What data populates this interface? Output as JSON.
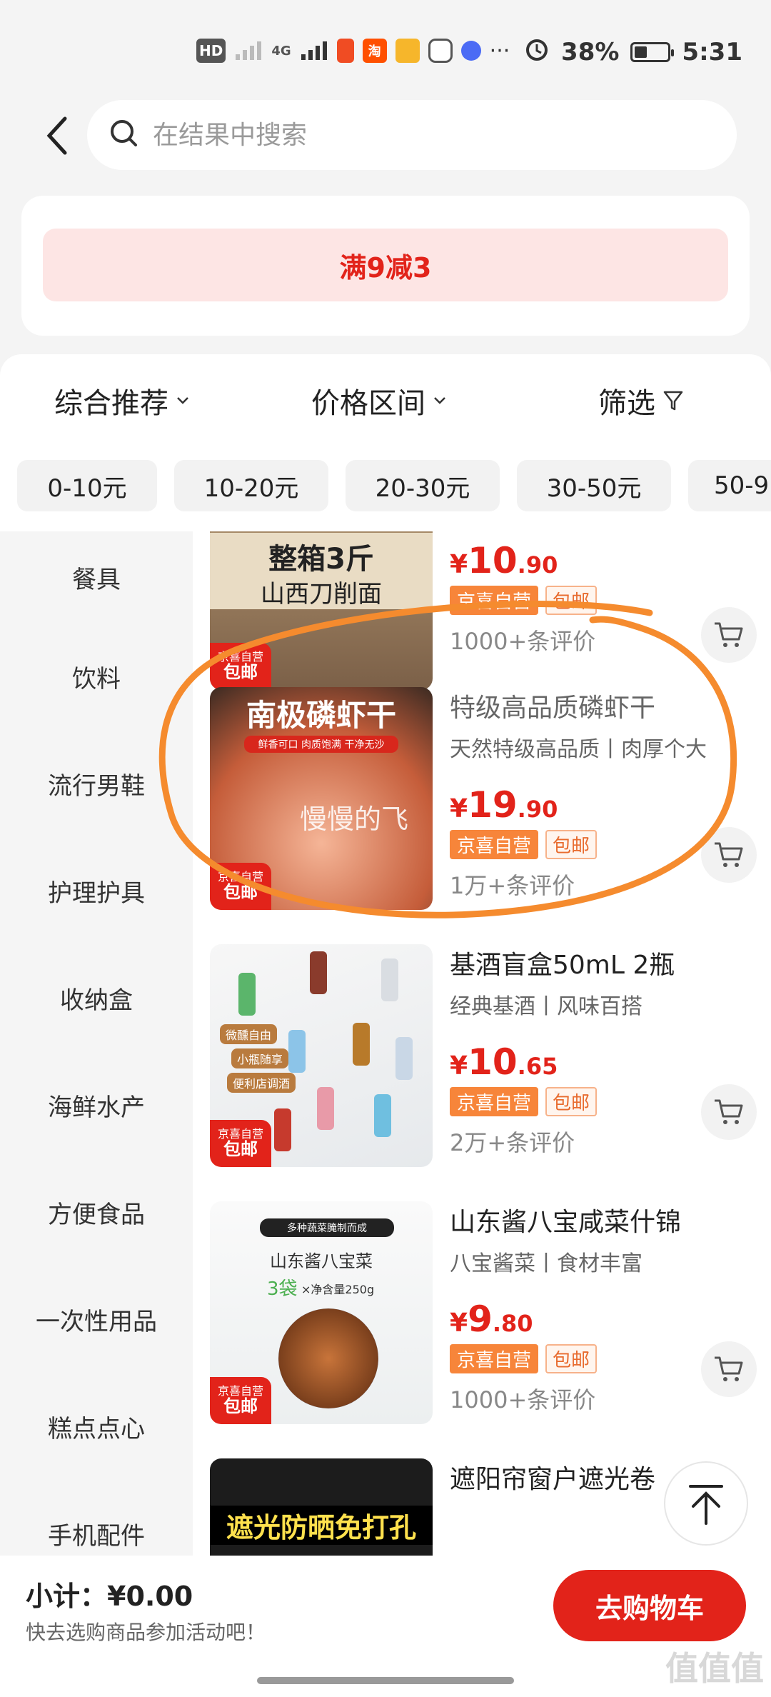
{
  "status_bar": {
    "hd": "HD",
    "net": "4G",
    "battery": "38%",
    "battery_level": 0.38,
    "time": "5:31",
    "dots": "···"
  },
  "search": {
    "placeholder": "在结果中搜索"
  },
  "promo": {
    "label": "满9减3"
  },
  "filters": {
    "tabs": [
      {
        "label": "综合推荐"
      },
      {
        "label": "价格区间"
      },
      {
        "label": "筛选"
      }
    ],
    "price_chips": [
      "0-10元",
      "10-20元",
      "20-30元",
      "30-50元",
      "50-9"
    ]
  },
  "sidebar": {
    "items": [
      "餐具",
      "饮料",
      "流行男鞋",
      "护理护具",
      "收纳盒",
      "海鲜水产",
      "方便食品",
      "一次性用品",
      "糕点点心",
      "手机配件"
    ]
  },
  "products": [
    {
      "image_text": "整箱3斤",
      "image_text2": "山西刀削面",
      "title": "",
      "subtitle": "",
      "price_yen": "¥",
      "price_int": "10",
      "price_dec": ".90",
      "tag_self": "京喜自营",
      "tag_ship": "包邮",
      "reviews": "1000+条评价",
      "badge1": "京喜自营",
      "badge2": "包邮"
    },
    {
      "image_text": "南极磷虾干",
      "image_text2": "鲜香可口 肉质饱满 干净无沙",
      "title": "特级高品质磷虾干",
      "subtitle": "天然特级高品质丨肉厚个大",
      "price_yen": "¥",
      "price_int": "19",
      "price_dec": ".90",
      "tag_self": "京喜自营",
      "tag_ship": "包邮",
      "reviews": "1万+条评价",
      "badge1": "京喜自营",
      "badge2": "包邮"
    },
    {
      "image_text": "微醺自由",
      "image_text2": "小瓶随享",
      "image_text3": "便利店调酒",
      "title": "基酒盲盒50mL  2瓶",
      "subtitle": "经典基酒丨风味百搭",
      "price_yen": "¥",
      "price_int": "10",
      "price_dec": ".65",
      "tag_self": "京喜自营",
      "tag_ship": "包邮",
      "reviews": "2万+条评价",
      "badge1": "京喜自营",
      "badge2": "包邮"
    },
    {
      "image_text": "多种蔬菜腌制而成",
      "image_text2": "山东酱八宝菜",
      "image_text3": "3袋",
      "image_text4": "×净含量250g",
      "title": "山东酱八宝咸菜什锦",
      "subtitle": "八宝酱菜丨食材丰富",
      "price_yen": "¥",
      "price_int": "9",
      "price_dec": ".80",
      "tag_self": "京喜自营",
      "tag_ship": "包邮",
      "reviews": "1000+条评价",
      "badge1": "京喜自营",
      "badge2": "包邮"
    },
    {
      "image_text": "遮光防晒免打孔",
      "title": "遮阳帘窗户遮光卷"
    }
  ],
  "watermark": "慢慢的飞",
  "footer": {
    "subtotal_label": "小计：",
    "subtotal_value": "¥0.00",
    "hint": "快去选购商品参加活动吧！",
    "checkout": "去购物车",
    "site_mark": "值值值"
  },
  "colors": {
    "accent": "#e2231a",
    "tag_orange": "#f7853a",
    "annotation": "#f58b2e"
  }
}
